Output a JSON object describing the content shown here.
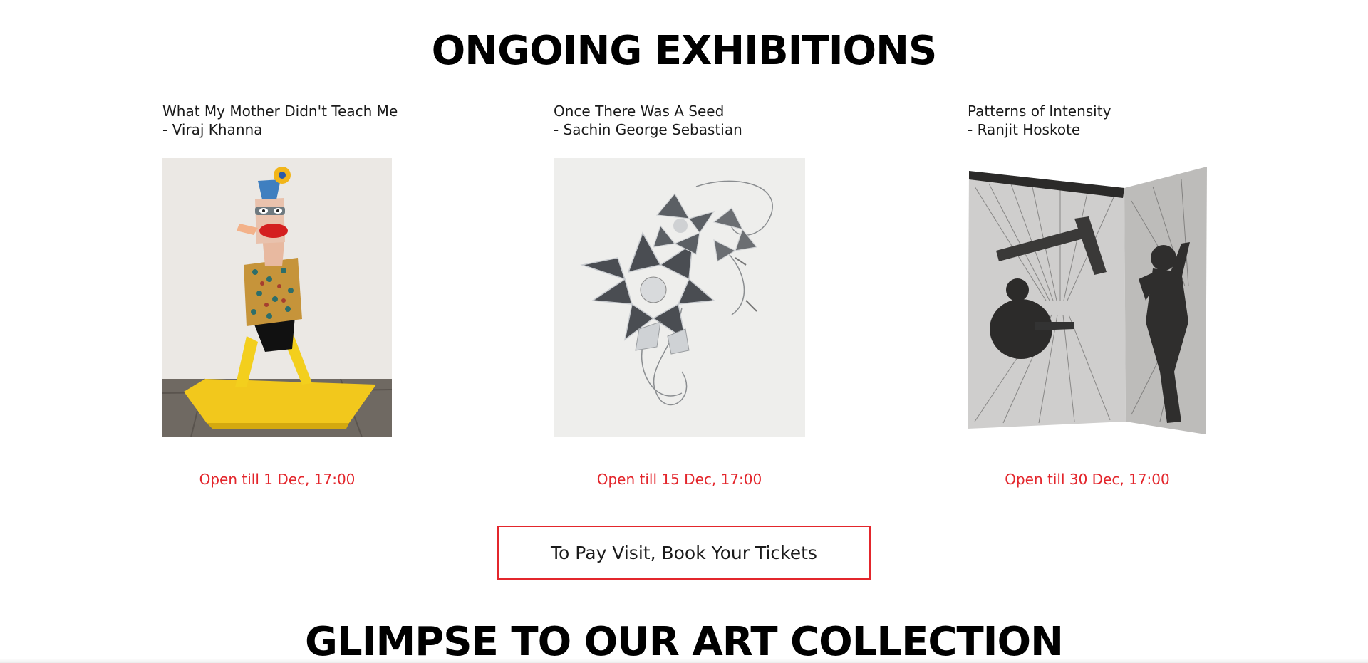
{
  "sections": {
    "ongoing_title": "ONGOING EXHIBITIONS",
    "collection_title": "GLIMPSE TO OUR ART COLLECTION"
  },
  "exhibitions": [
    {
      "title": "What My Mother Didn't Teach Me",
      "artist": "- Viraj Khanna",
      "status": "Open till 1 Dec, 17:00",
      "image": "sculpture-figure-on-yellow-boat"
    },
    {
      "title": "Once There Was A Seed",
      "artist": "- Sachin George Sebastian",
      "status": "Open till 15 Dec, 17:00",
      "image": "metal-flower-sculpture"
    },
    {
      "title": "Patterns of Intensity",
      "artist": "- Ranjit Hoskote",
      "status": "Open till 30 Dec, 17:00",
      "image": "charcoal-folded-panel-figures"
    }
  ],
  "cta": {
    "label": "To Pay Visit, Book Your Tickets"
  },
  "colors": {
    "accent": "#e3262c",
    "text": "#111111",
    "background": "#ffffff"
  }
}
